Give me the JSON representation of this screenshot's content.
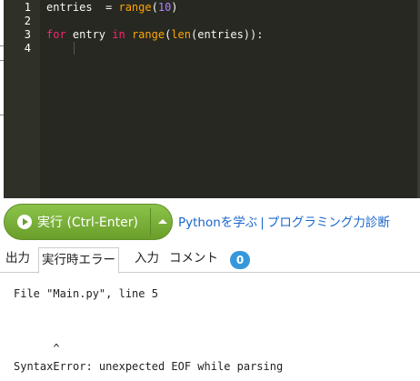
{
  "editor": {
    "line_numbers": [
      "1",
      "2",
      "3",
      "4"
    ],
    "code": {
      "line1": {
        "var": "entries",
        "op": "  = ",
        "fn": "range",
        "open": "(",
        "num": "10",
        "close": ")"
      },
      "line3": {
        "kw1": "for",
        "var": " entry ",
        "kw2": "in",
        "sp": " ",
        "fn1": "range",
        "p1": "(",
        "fn2": "len",
        "rest": "(entries)):"
      }
    },
    "theme": {
      "background": "#272822",
      "keyword": "#f92672",
      "function": "#ffa500",
      "number": "#ae81ff"
    }
  },
  "toolbar": {
    "run_label": "実行 (Ctrl-Enter)",
    "run_icon": "play-circle-icon",
    "dropdown_icon": "caret-up-icon",
    "link_learn": "Pythonを学ぶ",
    "separator": "|",
    "link_diagnosis": "プログラミング力診断",
    "accent_color": "#7cb342",
    "link_color": "#1a66cc"
  },
  "tabs": {
    "output": "出力",
    "runtime_error": "実行時エラー",
    "input": "入力",
    "comment": "コメント",
    "comment_count": "0",
    "badge_color": "#3598db"
  },
  "output": {
    "lines": [
      "File \"Main.py\", line 5",
      "",
      "",
      "      ^",
      "SyntaxError: unexpected EOF while parsing"
    ]
  }
}
